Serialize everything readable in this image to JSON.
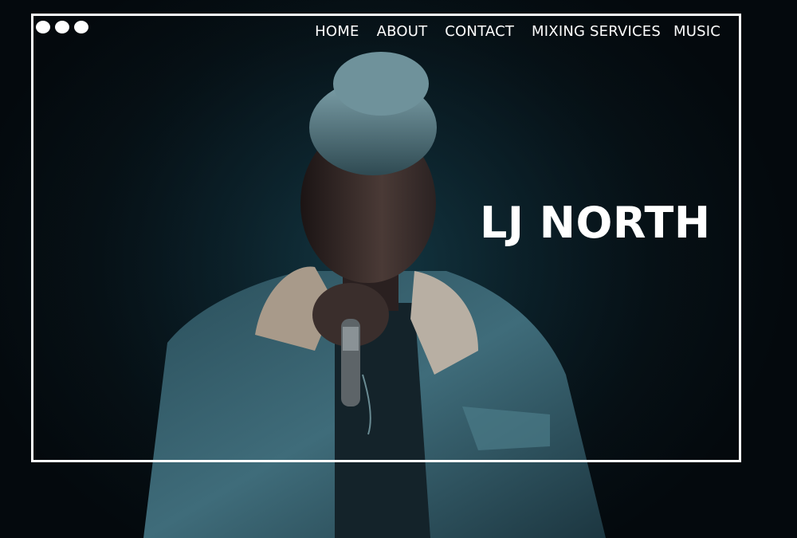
{
  "window_controls": {
    "dots": [
      "dot",
      "dot",
      "dot"
    ]
  },
  "nav": {
    "items": [
      {
        "label": "HOME"
      },
      {
        "label": "ABOUT"
      },
      {
        "label": "CONTACT"
      },
      {
        "label": "MIXING SERVICES"
      },
      {
        "label": "MUSIC"
      }
    ]
  },
  "hero": {
    "title": "LJ NORTH"
  },
  "colors": {
    "background": "#050b10",
    "accent": "#ffffff",
    "denim": "#3f6c7a"
  }
}
